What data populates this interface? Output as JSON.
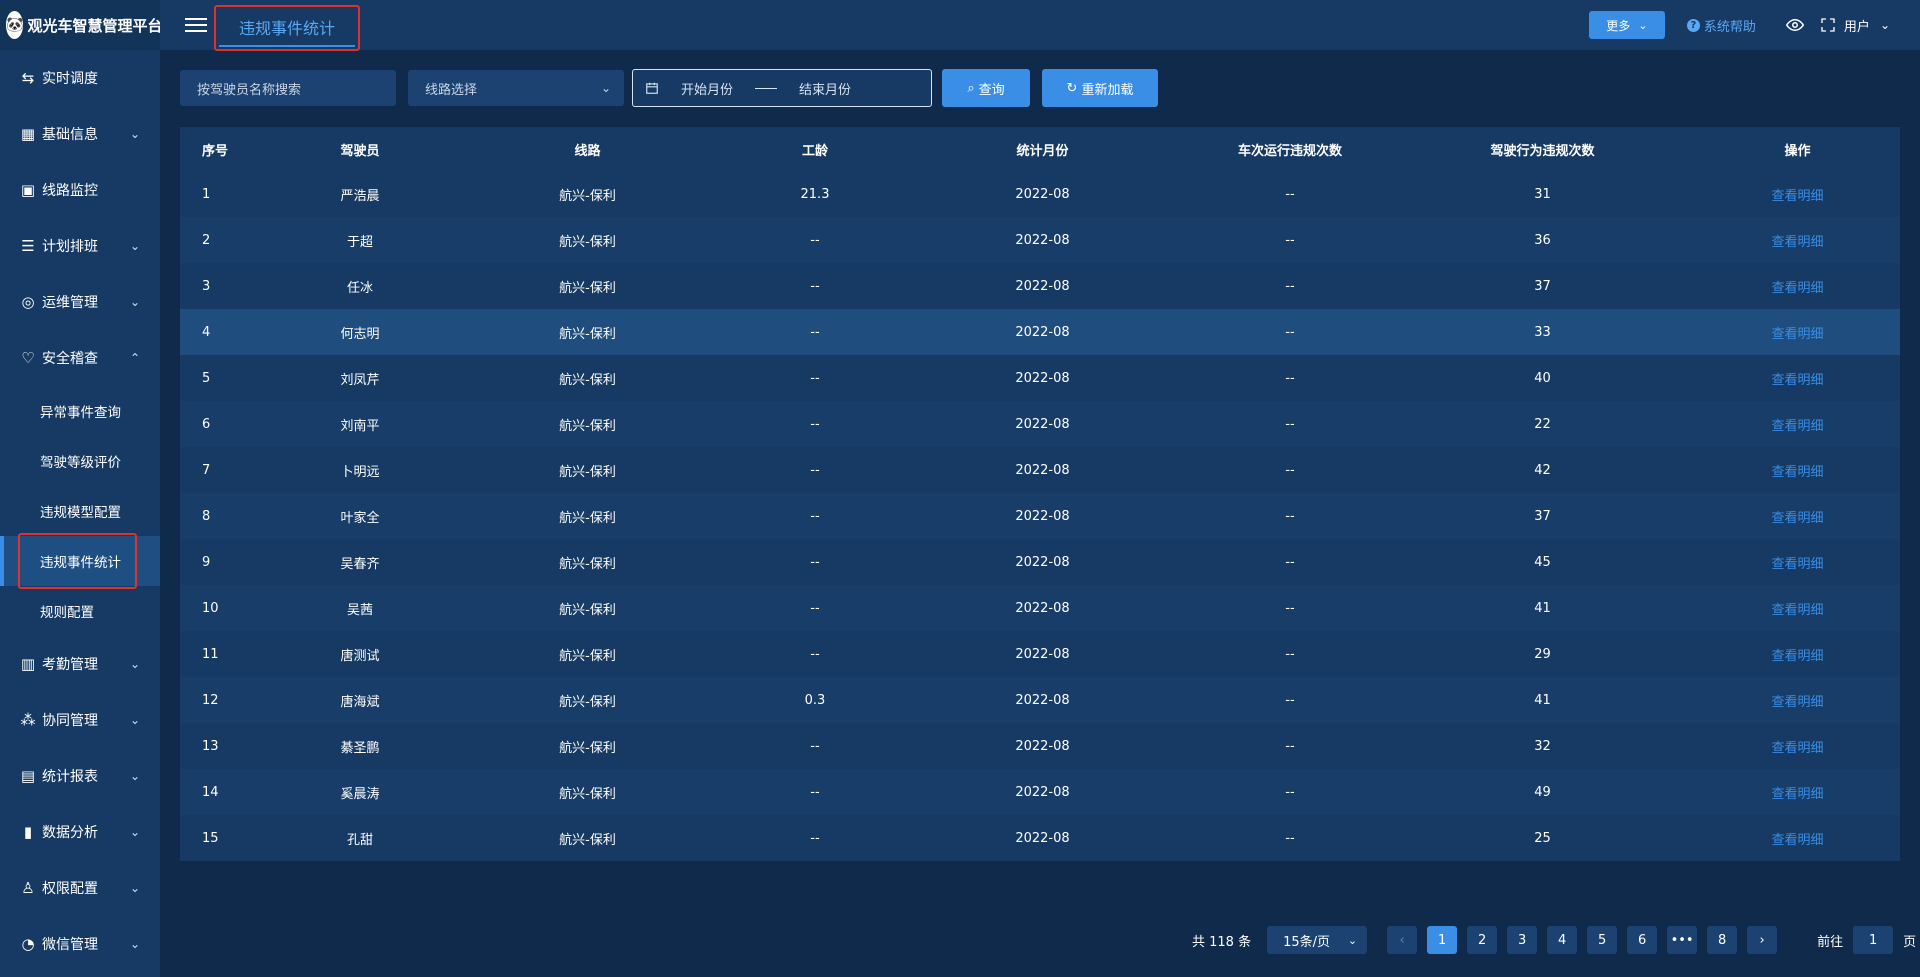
{
  "app": {
    "logo_glyph": "🐼",
    "title": "观光车智慧管理平台"
  },
  "header": {
    "active_tab": "违规事件统计",
    "more_label": "更多",
    "help_label": "系统帮助",
    "user_label": "用户"
  },
  "sidebar": {
    "items": [
      {
        "label": "实时调度",
        "icon": "swap-icon"
      },
      {
        "label": "基础信息",
        "icon": "grid-icon"
      },
      {
        "label": "线路监控",
        "icon": "monitor-icon"
      },
      {
        "label": "计划排班",
        "icon": "list-icon"
      },
      {
        "label": "运维管理",
        "icon": "circle-icon"
      },
      {
        "label": "安全稽查",
        "icon": "heart-icon"
      },
      {
        "label": "考勤管理",
        "icon": "calendar-icon"
      },
      {
        "label": "协同管理",
        "icon": "cluster-icon"
      },
      {
        "label": "统计报表",
        "icon": "report-icon"
      },
      {
        "label": "数据分析",
        "icon": "bar-chart-icon"
      },
      {
        "label": "权限配置",
        "icon": "user-icon"
      },
      {
        "label": "微信管理",
        "icon": "wechat-icon"
      }
    ],
    "safety_sub": [
      "异常事件查询",
      "驾驶等级评价",
      "违规模型配置",
      "违规事件统计",
      "规则配置"
    ]
  },
  "filters": {
    "driver_placeholder": "按驾驶员名称搜索",
    "route_placeholder": "线路选择",
    "start_month": "开始月份",
    "end_month": "结束月份",
    "query_label": "查询",
    "reload_label": "重新加载"
  },
  "table": {
    "columns": [
      "序号",
      "驾驶员",
      "线路",
      "工龄",
      "统计月份",
      "车次运行违规次数",
      "驾驶行为违规次数",
      "操作"
    ],
    "rows": [
      [
        "1",
        "严浩晨",
        "航兴-保利",
        "21.3",
        "2022-08",
        "--",
        "31",
        "查看明细"
      ],
      [
        "2",
        "于超",
        "航兴-保利",
        "--",
        "2022-08",
        "--",
        "36",
        "查看明细"
      ],
      [
        "3",
        "任冰",
        "航兴-保利",
        "--",
        "2022-08",
        "--",
        "37",
        "查看明细"
      ],
      [
        "4",
        "何志明",
        "航兴-保利",
        "--",
        "2022-08",
        "--",
        "33",
        "查看明细"
      ],
      [
        "5",
        "刘凤芹",
        "航兴-保利",
        "--",
        "2022-08",
        "--",
        "40",
        "查看明细"
      ],
      [
        "6",
        "刘南平",
        "航兴-保利",
        "--",
        "2022-08",
        "--",
        "22",
        "查看明细"
      ],
      [
        "7",
        "卜明远",
        "航兴-保利",
        "--",
        "2022-08",
        "--",
        "42",
        "查看明细"
      ],
      [
        "8",
        "叶家全",
        "航兴-保利",
        "--",
        "2022-08",
        "--",
        "37",
        "查看明细"
      ],
      [
        "9",
        "吴春齐",
        "航兴-保利",
        "--",
        "2022-08",
        "--",
        "45",
        "查看明细"
      ],
      [
        "10",
        "吴茜",
        "航兴-保利",
        "--",
        "2022-08",
        "--",
        "41",
        "查看明细"
      ],
      [
        "11",
        "唐测试",
        "航兴-保利",
        "--",
        "2022-08",
        "--",
        "29",
        "查看明细"
      ],
      [
        "12",
        "唐海斌",
        "航兴-保利",
        "0.3",
        "2022-08",
        "--",
        "41",
        "查看明细"
      ],
      [
        "13",
        "綦圣鹏",
        "航兴-保利",
        "--",
        "2022-08",
        "--",
        "32",
        "查看明细"
      ],
      [
        "14",
        "奚晨涛",
        "航兴-保利",
        "--",
        "2022-08",
        "--",
        "49",
        "查看明细"
      ],
      [
        "15",
        "孔甜",
        "航兴-保利",
        "--",
        "2022-08",
        "--",
        "25",
        "查看明细"
      ]
    ]
  },
  "pagination": {
    "total": "共 118 条",
    "page_size": "15条/页",
    "pages": [
      "1",
      "2",
      "3",
      "4",
      "5",
      "6",
      "•••",
      "8"
    ],
    "current": "1",
    "goto_prefix": "前往",
    "goto_value": "1",
    "goto_suffix": "页"
  },
  "colors": {
    "accent": "#3a8ee6",
    "highlight_box": "#e0312f",
    "background": "#0f2a4a",
    "panel": "#163a63"
  }
}
